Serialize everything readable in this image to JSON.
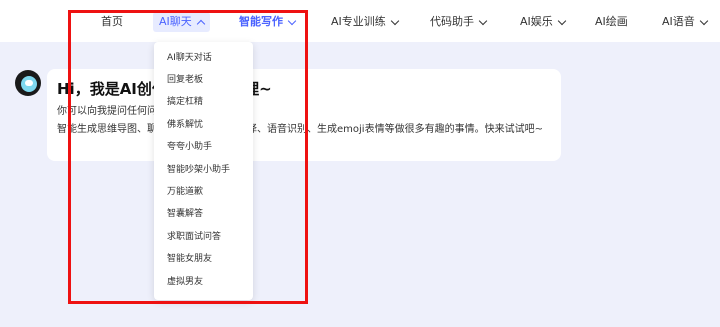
{
  "nav": {
    "home": "首页",
    "ai_chat": "AI聊天",
    "smart_writing": "智能写作",
    "ai_training": "AI专业训练",
    "code_assistant": "代码助手",
    "ai_entertainment": "AI娱乐",
    "ai_drawing": "AI绘画",
    "ai_voice": "AI语音"
  },
  "dropdown": {
    "items": [
      "AI聊天对话",
      "回复老板",
      "搞定杠精",
      "佛系解忧",
      "夸夸小助手",
      "智能吵架小助手",
      "万能道歉",
      "智囊解答",
      "求职面试问答",
      "智能女朋友",
      "虚拟男友"
    ]
  },
  "card": {
    "title": "Hi，我是AI创作专属AI小助理~",
    "subtitle": "你可以向我提问任何问题",
    "description": "智能生成思维导图、聊天、写作、编程、翻译、语音识别、生成emoji表情等做很多有趣的事情。快来试试吧~"
  },
  "colors": {
    "accent": "#4b63ff",
    "annotation_box": "#ee1111",
    "background": "#eef0fb"
  }
}
